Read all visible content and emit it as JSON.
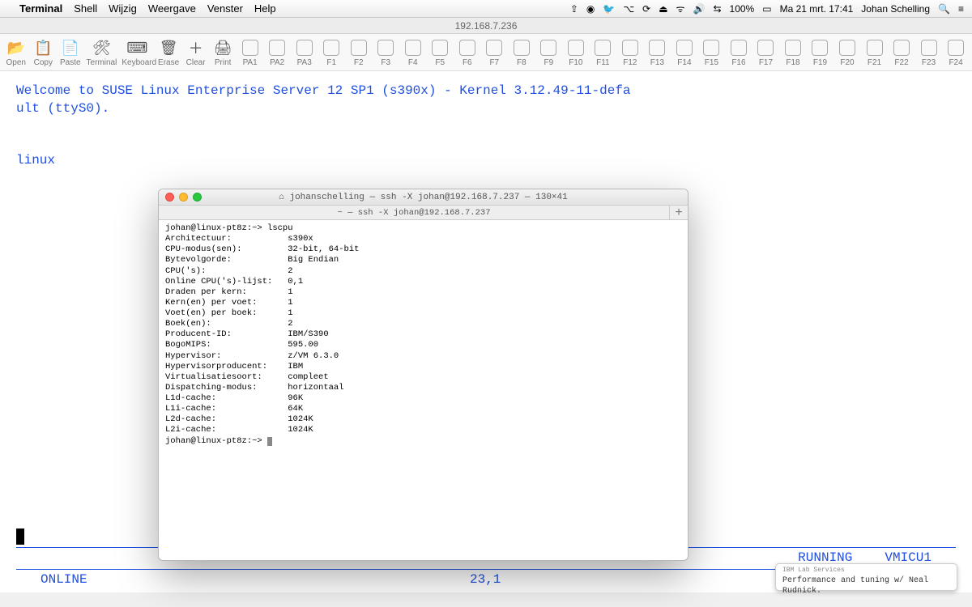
{
  "menubar": {
    "apple": "",
    "app": "Terminal",
    "items": [
      "Shell",
      "Wijzig",
      "Weergave",
      "Venster",
      "Help"
    ],
    "right": {
      "glyphs": [
        "⇪",
        "◉",
        "🐦",
        "⌥",
        "⟳",
        "⏏",
        "ᯤ",
        "🔊",
        "⇆"
      ],
      "battery": "100%",
      "battery_icon": "▭",
      "date": "Ma 21 mrt.  17:41",
      "user": "Johan Schelling",
      "search": "🔍",
      "menu": "≡"
    }
  },
  "window": {
    "title": "192.168.7.236"
  },
  "toolbar": {
    "main": [
      {
        "icon": "📂",
        "label": "Open"
      },
      {
        "icon": "📋",
        "label": "Copy"
      },
      {
        "icon": "📄",
        "label": "Paste"
      },
      {
        "icon": "🛠",
        "label": "Terminal"
      },
      {
        "icon": "⌨",
        "label": "Keyboard"
      },
      {
        "icon": "🗑",
        "label": "Erase"
      },
      {
        "icon": "＋",
        "label": "Clear"
      },
      {
        "icon": "🖨",
        "label": "Print"
      }
    ],
    "fkeys": [
      "PA1",
      "PA2",
      "PA3",
      "F1",
      "F2",
      "F3",
      "F4",
      "F5",
      "F6",
      "F7",
      "F8",
      "F9",
      "F10",
      "F11",
      "F12",
      "F13",
      "F14",
      "F15",
      "F16",
      "F17",
      "F18",
      "F19",
      "F20",
      "F21",
      "F22",
      "F23",
      "F24"
    ]
  },
  "main_term": {
    "line1": "Welcome to SUSE Linux Enterprise Server 12 SP1  (s390x) - Kernel 3.12.49-11-defa",
    "line2": "ult (ttyS0).",
    "line3": "",
    "line4": "linux",
    "status1_right1": "RUNNING",
    "status1_right2": "VMICU1",
    "status2_left": "ONLINE",
    "status2_mid": "23,1"
  },
  "popup": {
    "title_prefix": "⌂",
    "title": "johanschelling — ssh -X johan@192.168.7.237 — 130×41",
    "tab": "~ — ssh -X johan@192.168.7.237",
    "prompt1": "johan@linux-pt8z:~> lscpu",
    "rows": [
      [
        "Architectuur:",
        "s390x"
      ],
      [
        "CPU-modus(sen):",
        "32-bit, 64-bit"
      ],
      [
        "Bytevolgorde:",
        "Big Endian"
      ],
      [
        "CPU('s):",
        "2"
      ],
      [
        "Online CPU('s)-lijst:",
        "0,1"
      ],
      [
        "Draden per kern:",
        "1"
      ],
      [
        "Kern(en) per voet:",
        "1"
      ],
      [
        "Voet(en) per boek:",
        "1"
      ],
      [
        "Boek(en):",
        "2"
      ],
      [
        "Producent-ID:",
        "IBM/S390"
      ],
      [
        "BogoMIPS:",
        "595.00"
      ],
      [
        "Hypervisor:",
        "z/VM 6.3.0"
      ],
      [
        "Hypervisorproducent:",
        "IBM"
      ],
      [
        "Virtualisatiesoort:",
        "compleet"
      ],
      [
        "Dispatching-modus:",
        "horizontaal"
      ],
      [
        "L1d-cache:",
        "96K"
      ],
      [
        "L1i-cache:",
        "64K"
      ],
      [
        "L2d-cache:",
        "1024K"
      ],
      [
        "L2i-cache:",
        "1024K"
      ]
    ],
    "prompt2": "johan@linux-pt8z:~> "
  },
  "notif": {
    "head": "IBM Lab Services",
    "body": "Performance and tuning w/ Neal Rudnick."
  }
}
